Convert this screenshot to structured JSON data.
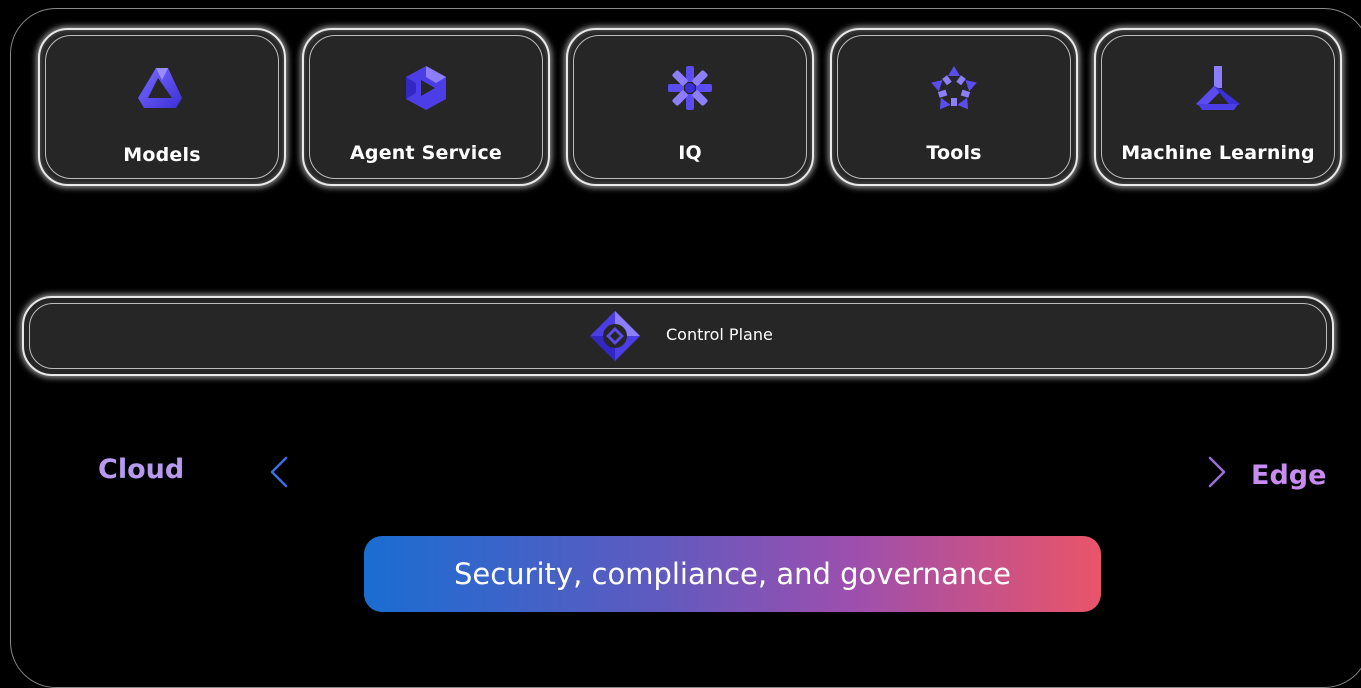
{
  "services": [
    {
      "label": "Models",
      "icon": "models-icon"
    },
    {
      "label": "Agent Service",
      "icon": "agent-service-icon"
    },
    {
      "label": "IQ",
      "icon": "iq-icon"
    },
    {
      "label": "Tools",
      "icon": "tools-icon"
    },
    {
      "label": "Machine Learning",
      "icon": "machine-learning-icon"
    }
  ],
  "control_plane": {
    "label": "Control Plane",
    "icon": "control-plane-icon"
  },
  "axis": {
    "left_label": "Cloud",
    "right_label": "Edge"
  },
  "banner": {
    "label": "Security, compliance, and governance"
  },
  "colors": {
    "icon_blue": "#5b4cf0",
    "banner_start": "#1a6dd2",
    "banner_end": "#ea5469",
    "cloud_text": "#b79af0",
    "edge_text": "#c88bf2"
  }
}
